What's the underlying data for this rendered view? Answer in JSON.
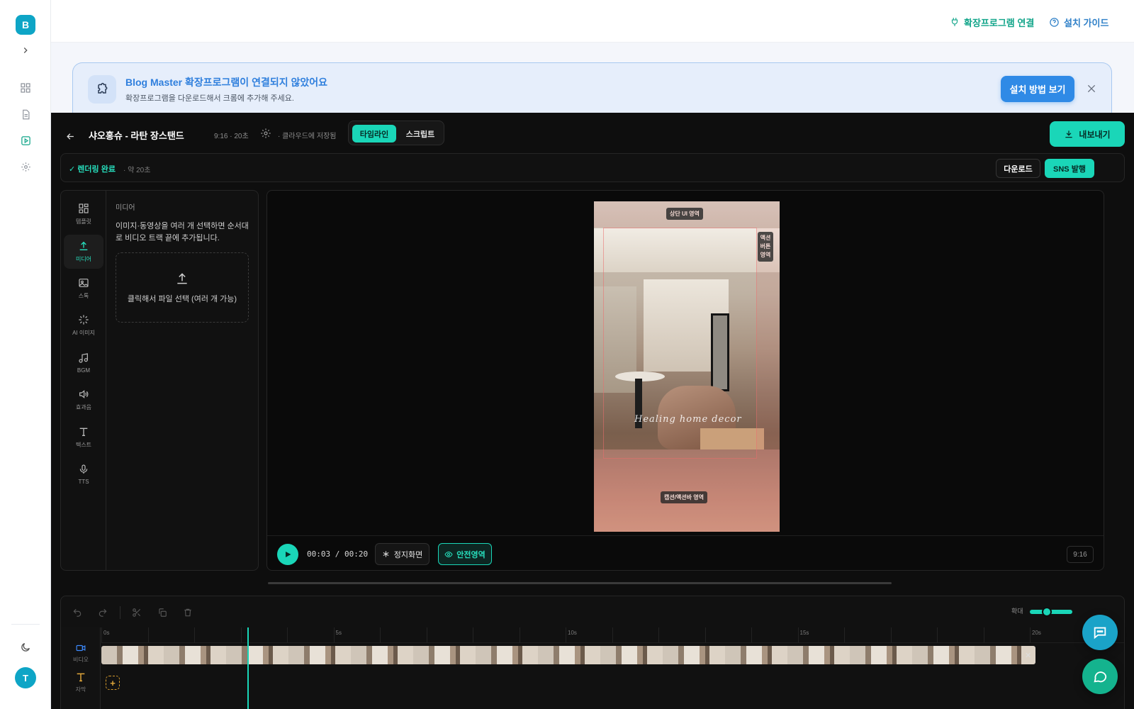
{
  "app": {
    "logo_letter": "B",
    "avatar_letter": "T"
  },
  "topbar": {
    "extension_link": "확장프로그램 연결",
    "guide_link": "설치 가이드"
  },
  "banner": {
    "title": "Blog Master 확장프로그램이 연결되지 않았어요",
    "subtitle": "확장프로그램을 다운로드해서 크롬에 추가해 주세요.",
    "button": "설치 방법 보기"
  },
  "project": {
    "title": "샤오홍슈 - 라탄 장스탠드",
    "meta": "9:16 · 20초",
    "saved": "· 클라우드에 저장됨",
    "tabs": [
      {
        "label": "타임라인",
        "active": true
      },
      {
        "label": "스크립트",
        "active": false
      }
    ],
    "export": "내보내기"
  },
  "status": {
    "label": "렌더링 완료",
    "sub": "· 약 20초",
    "download": "다운로드",
    "publish": "SNS 발행"
  },
  "tools": [
    {
      "label": "템플릿",
      "icon": "template-icon"
    },
    {
      "label": "미디어",
      "icon": "upload-icon",
      "active": true
    },
    {
      "label": "스톡",
      "icon": "image-icon"
    },
    {
      "label": "AI 이미지",
      "icon": "sparkle-icon"
    },
    {
      "label": "BGM",
      "icon": "music-icon"
    },
    {
      "label": "효과음",
      "icon": "speaker-icon"
    },
    {
      "label": "텍스트",
      "icon": "text-icon"
    },
    {
      "label": "TTS",
      "icon": "mic-icon"
    }
  ],
  "media_panel": {
    "title": "미디어",
    "description": "이미지·동영상을 여러 개 선택하면 순서대로 비디오 트랙 끝에 추가됩니다.",
    "dropzone": "클릭해서 파일 선택 (여러 개 가능)"
  },
  "preview": {
    "zone_top": "상단 UI 영역",
    "zone_right": "액션버튼영역",
    "zone_bottom": "캡션/액션바 영역",
    "overlay_text": "Healing home decor"
  },
  "player": {
    "time": "00:03 / 00:20",
    "progress": 0.15,
    "still_button": "정지화면",
    "safe_button": "안전영역",
    "ratio": "9:16"
  },
  "timeline": {
    "zoom_label": "확대",
    "zoom_level": 0.55,
    "ticks": [
      "0s",
      "5s",
      "10s",
      "15s",
      "20s"
    ],
    "tracks": [
      {
        "label": "비디오",
        "icon": "video-icon"
      },
      {
        "label": "자막",
        "icon": "text-icon"
      }
    ]
  },
  "colors": {
    "accent": "#1ad6b8",
    "brand": "#0ea5c6",
    "banner_blue": "#2f8ae6"
  }
}
